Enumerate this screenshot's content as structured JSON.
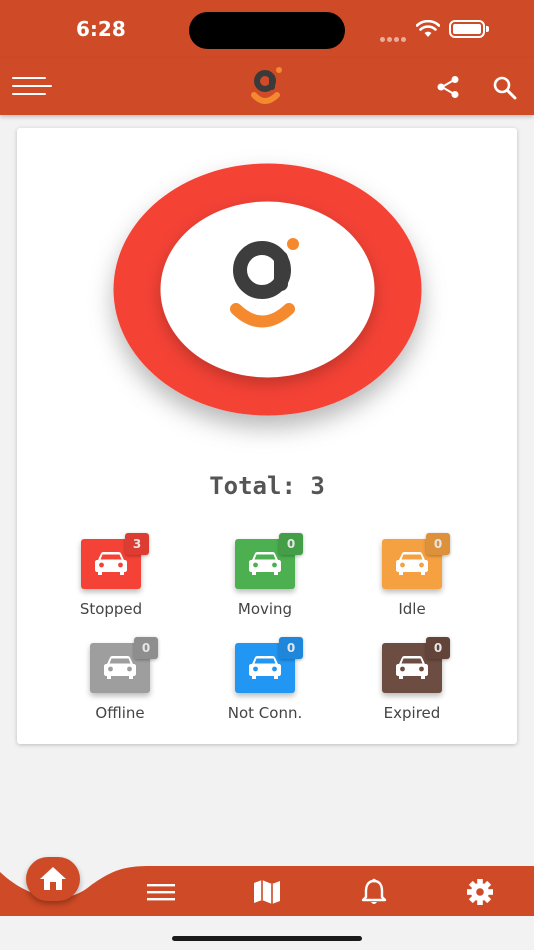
{
  "status_bar": {
    "time": "6:28"
  },
  "app_bar": {
    "logo_icon": "g-smile-logo",
    "menu_icon": "hamburger-menu-icon",
    "share_icon": "share-icon",
    "search_icon": "search-icon"
  },
  "dashboard": {
    "total_text": "Total: 3",
    "ring_color": "#f44336",
    "items": [
      {
        "label": "Stopped",
        "count": "3",
        "color": "#f44336"
      },
      {
        "label": "Moving",
        "count": "0",
        "color": "#4caf50"
      },
      {
        "label": "Idle",
        "count": "0",
        "color": "#f5a142"
      },
      {
        "label": "Offline",
        "count": "0",
        "color": "#9e9e9e"
      },
      {
        "label": "Not Conn.",
        "count": "0",
        "color": "#2196f3"
      },
      {
        "label": "Expired",
        "count": "0",
        "color": "#6d4c41"
      }
    ]
  },
  "bottom_nav": {
    "items": [
      "home-icon",
      "list-icon",
      "map-icon",
      "bell-icon",
      "gear-icon"
    ],
    "accent": "#cf4a26"
  }
}
